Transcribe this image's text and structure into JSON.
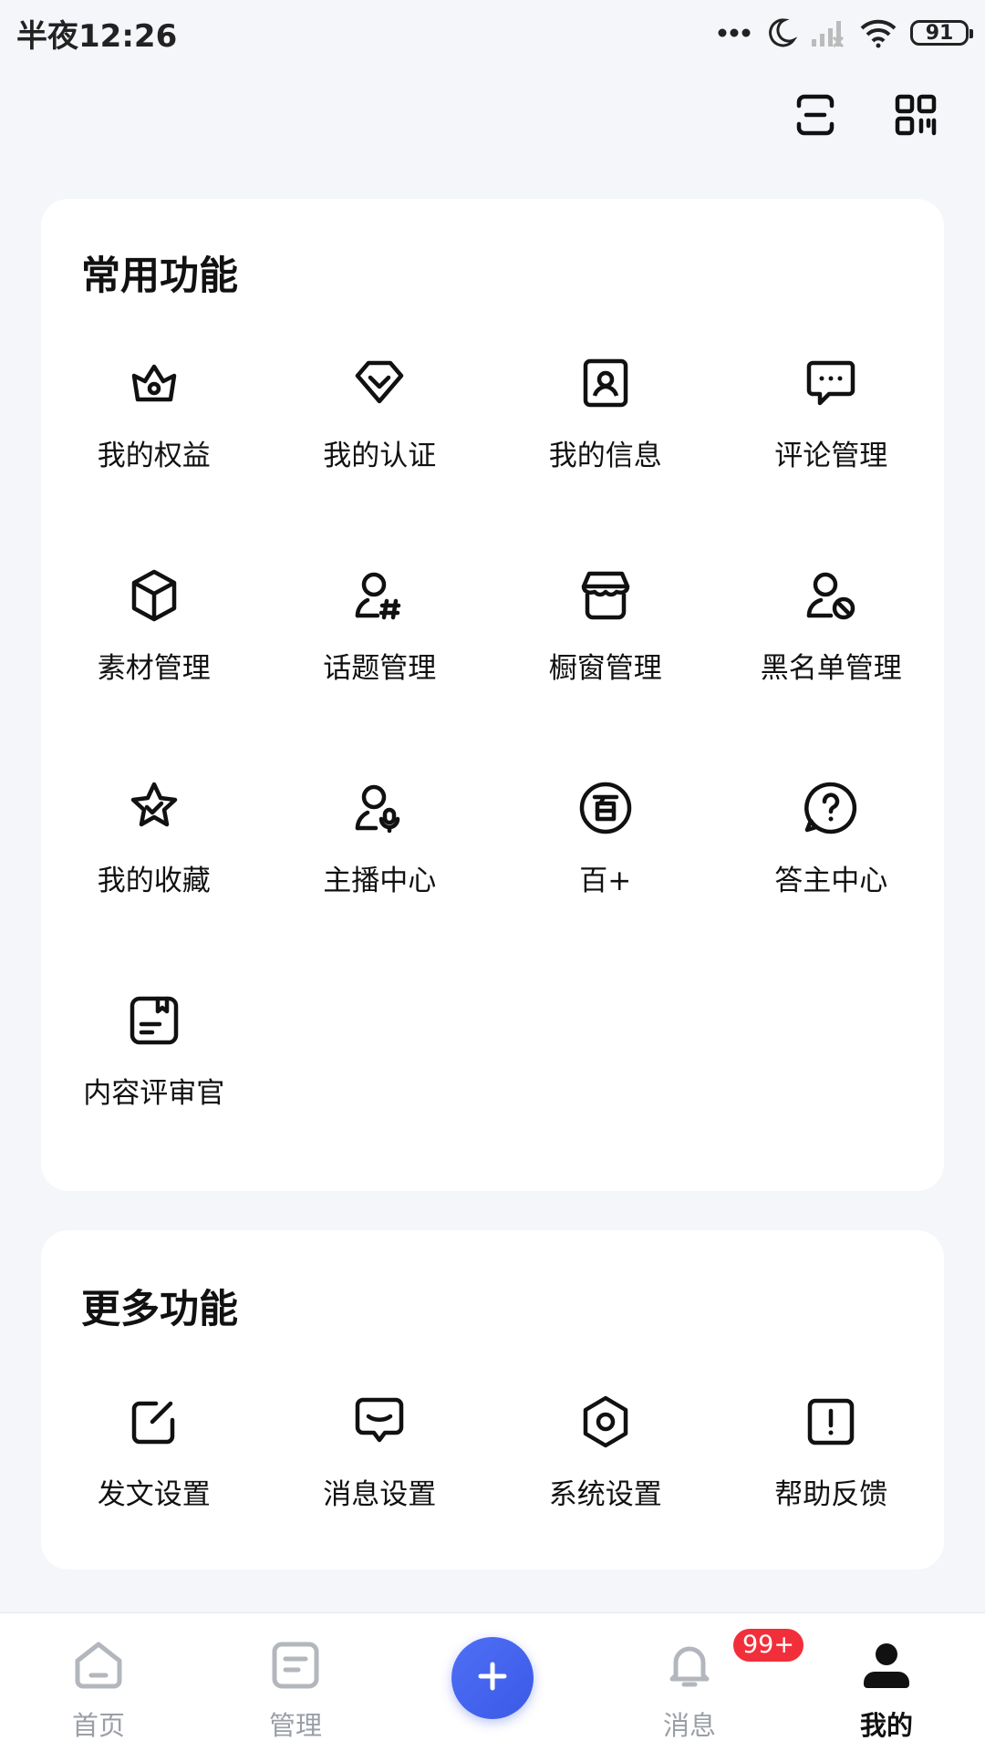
{
  "status_bar": {
    "time": "半夜12:26",
    "battery": "91"
  },
  "top_actions": {
    "icons": [
      "scan-icon",
      "qrcode-icon"
    ]
  },
  "common": {
    "title": "常用功能",
    "items": [
      {
        "label": "我的权益",
        "icon": "crown-icon"
      },
      {
        "label": "我的认证",
        "icon": "verify-badge-icon"
      },
      {
        "label": "我的信息",
        "icon": "profile-card-icon"
      },
      {
        "label": "评论管理",
        "icon": "comment-icon"
      },
      {
        "label": "素材管理",
        "icon": "cube-icon"
      },
      {
        "label": "话题管理",
        "icon": "user-hash-icon"
      },
      {
        "label": "橱窗管理",
        "icon": "storefront-icon"
      },
      {
        "label": "黑名单管理",
        "icon": "user-block-icon"
      },
      {
        "label": "我的收藏",
        "icon": "star-check-icon"
      },
      {
        "label": "主播中心",
        "icon": "user-mic-icon"
      },
      {
        "label": "百+",
        "icon": "bai-circle-icon"
      },
      {
        "label": "答主中心",
        "icon": "question-circle-icon"
      },
      {
        "label": "内容评审官",
        "icon": "review-doc-icon"
      }
    ]
  },
  "more": {
    "title": "更多功能",
    "items": [
      {
        "label": "发文设置",
        "icon": "edit-square-icon"
      },
      {
        "label": "消息设置",
        "icon": "message-icon"
      },
      {
        "label": "系统设置",
        "icon": "hexagon-settings-icon"
      },
      {
        "label": "帮助反馈",
        "icon": "alert-square-icon"
      }
    ]
  },
  "bottom_nav": {
    "home": "首页",
    "manage": "管理",
    "message": "消息",
    "message_badge": "99+",
    "me": "我的",
    "active": "me"
  },
  "colors": {
    "accent": "#4064f0",
    "badge": "#f12f3a",
    "background": "#f4f6f9"
  }
}
